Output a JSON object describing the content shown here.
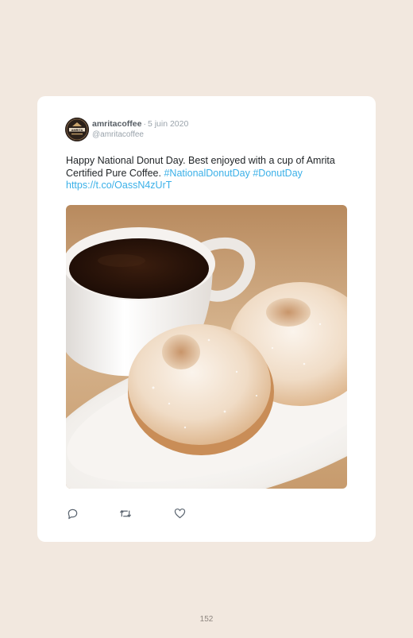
{
  "tweet": {
    "display_name": "amritacoffee",
    "date": "5 juin 2020",
    "handle": "@amritacoffee",
    "avatar_text": "AMRITA",
    "text_plain": "Happy National Donut Day. Best enjoyed with a cup of Amrita Certified Pure Coffee.",
    "hashtag_1": "#NationalDonutDay",
    "hashtag_2": "#DonutDay",
    "link": "https://t.co/OassN4zUrT",
    "image_alt": "cup-of-coffee-with-two-powdered-donuts-on-plate",
    "icons": [
      "reply-icon",
      "retweet-icon",
      "like-icon"
    ]
  },
  "page": {
    "number": "152"
  },
  "colors": {
    "background": "#f2e8df",
    "card": "#ffffff",
    "link": "#3ab0e8",
    "muted": "#9aa3ab"
  }
}
